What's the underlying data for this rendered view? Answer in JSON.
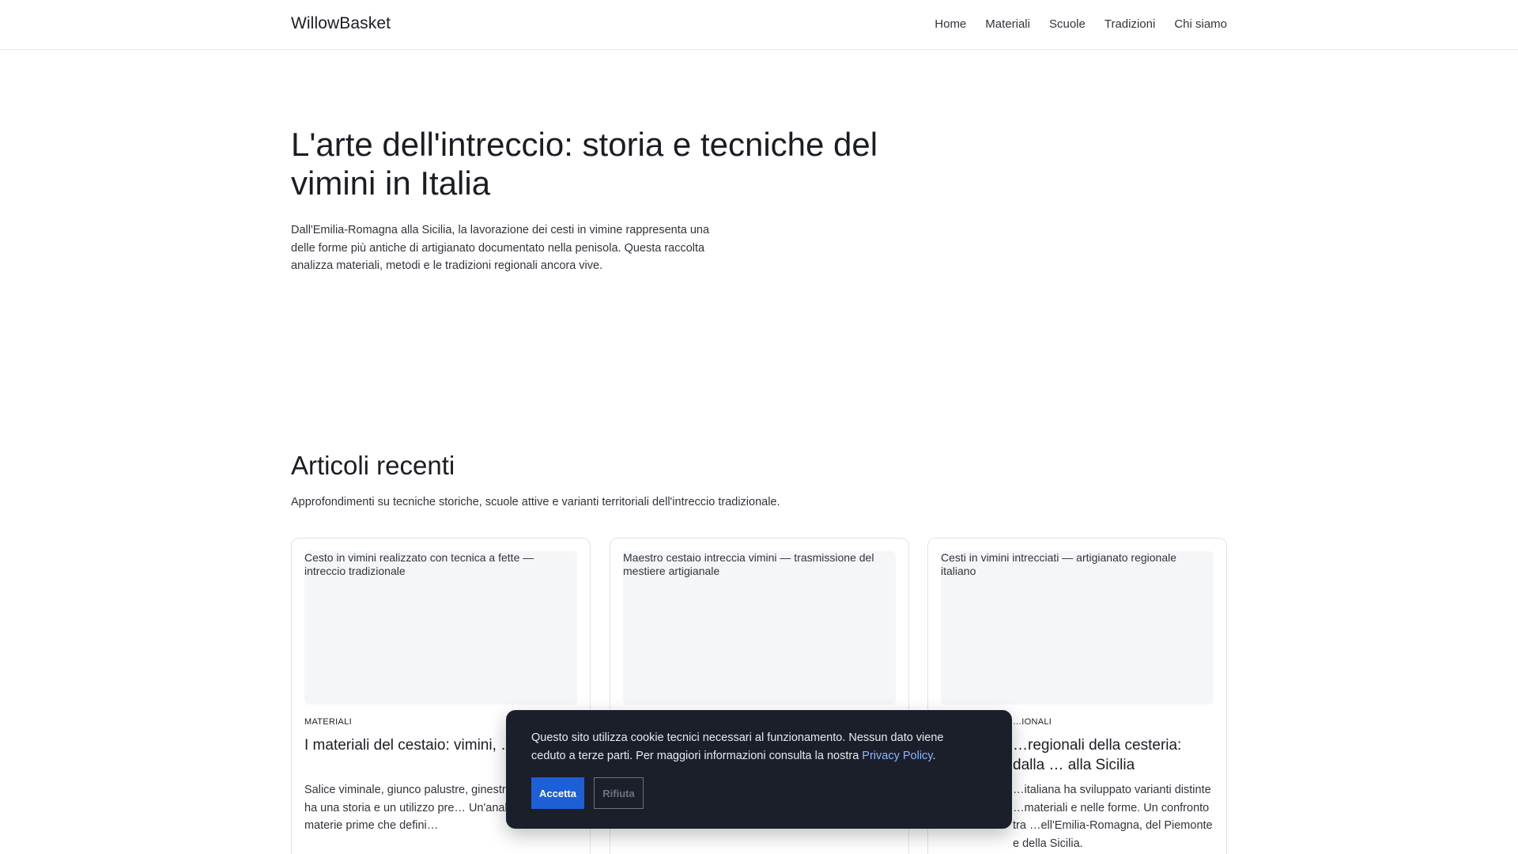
{
  "site": {
    "brand": "WillowBasket"
  },
  "nav": {
    "items": [
      {
        "label": "Home"
      },
      {
        "label": "Materiali"
      },
      {
        "label": "Scuole"
      },
      {
        "label": "Tradizioni"
      },
      {
        "label": "Chi siamo"
      }
    ]
  },
  "hero": {
    "title": "L'arte dell'intreccio: storia e tecniche del vimini in Italia",
    "lead": "Dall'Emilia-Romagna alla Sicilia, la lavorazione dei cesti in vimine rappresenta una delle forme più antiche di artigianato documentato nella penisola. Questa raccolta analizza materiali, metodi e le tradizioni regionali ancora vive."
  },
  "recent": {
    "title": "Articoli recenti",
    "lead": "Approfondimenti su tecniche storiche, scuole attive e varianti territoriali dell'intreccio tradizionale."
  },
  "cards": [
    {
      "image_alt": "Cesto in vimini realizzato con tecnica a fette — intreccio tradizionale",
      "category": "Materiali",
      "title": "I materiali del cestaio: vimini, … ginestra",
      "excerpt": "Salice viminale, giunco palustre, ginestr… ogni fibra ha una storia e un utilizzo pre… Un'analisi delle materie prime che defini…"
    },
    {
      "image_alt": "Maestro cestaio intreccia vimini — trasmissione del mestiere artigianale",
      "category": "",
      "title": "",
      "excerpt": ""
    },
    {
      "image_alt": "Cesti in vimini intrecciati — artigianato regionale italiano",
      "category": "…ionali",
      "title": "…regionali della cesteria: dalla … alla Sicilia",
      "excerpt": "…italiana ha sviluppato varianti distinte …materiali e nelle forme. Un confronto tra …ell'Emilia-Romagna, del Piemonte e della Sicilia."
    }
  ],
  "cookie": {
    "message": "Questo sito utilizza cookie tecnici necessari al funzionamento. Nessun dato viene ceduto a terze parti. Per maggiori informazioni consulta la nostra",
    "link_label": "Privacy Policy",
    "suffix": ".",
    "accept_label": "Accetta",
    "reject_label": "Rifiuta"
  }
}
